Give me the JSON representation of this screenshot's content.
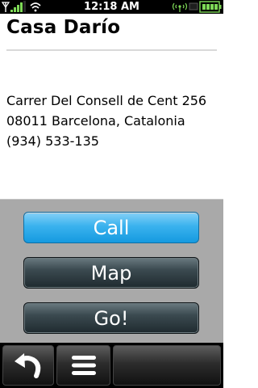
{
  "status_bar": {
    "time": "12:18 AM",
    "icons": [
      "signal-bars-icon",
      "wifi-icon",
      "radio-tower-icon",
      "battery-icon"
    ],
    "signal_bars": 4,
    "battery_level": 1.0
  },
  "header": {
    "title": "Casa Darío"
  },
  "details": {
    "street": "Carrer Del Consell de Cent 256",
    "city_line": "08011 Barcelona, Catalonia",
    "phone": "(934) 533-135"
  },
  "actions": {
    "call_label": "Call",
    "map_label": "Map",
    "go_label": "Go!"
  },
  "bottom_nav": {
    "back_icon": "back-arrow-icon",
    "menu_icon": "menu-icon"
  },
  "colors": {
    "accent_call": "#159ae0",
    "button_dark": "#2f3b40",
    "panel_bg": "#a9a9a9",
    "status_green": "#7ed957"
  }
}
